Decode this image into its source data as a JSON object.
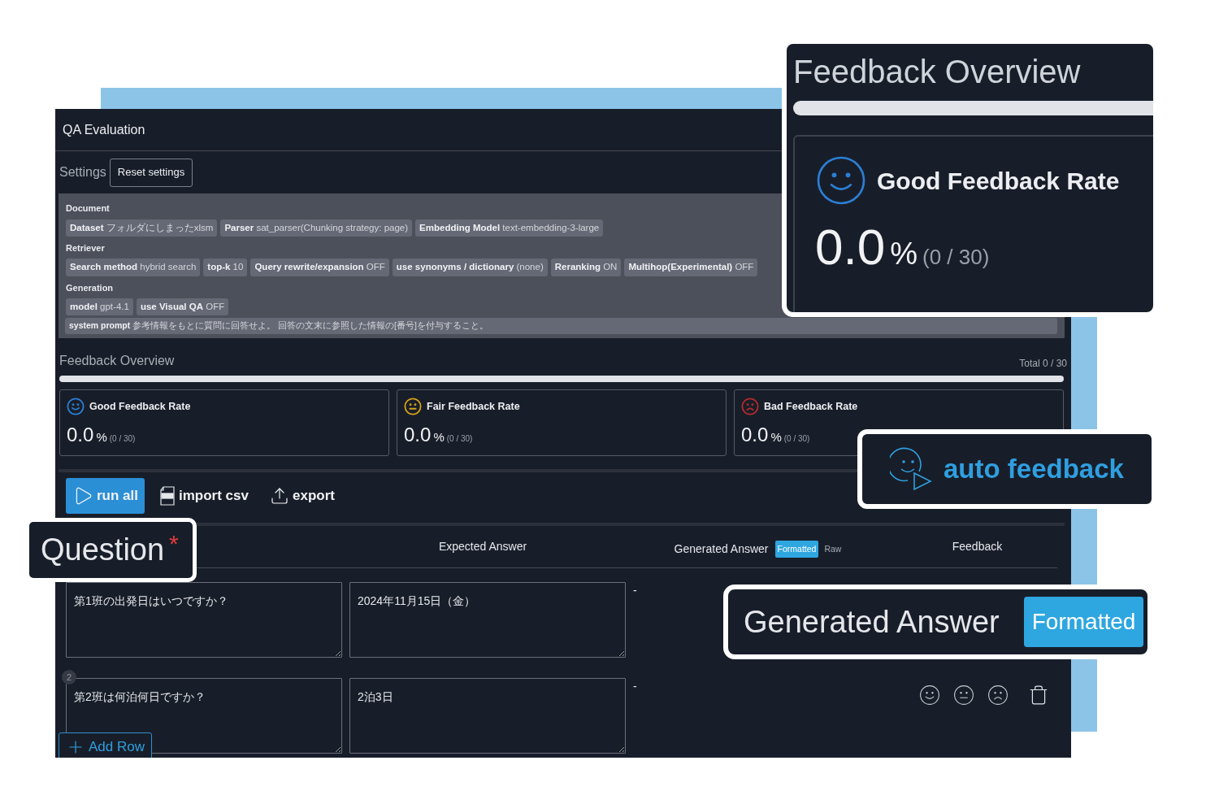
{
  "window": {
    "title": "QA Evaluation"
  },
  "settings": {
    "label": "Settings",
    "reset_button": "Reset settings",
    "groups": [
      {
        "title": "Document",
        "chips": [
          "**Dataset** フォルダにしまったxlsm",
          "**Parser** sat_parser(Chunking strategy: page)",
          "**Embedding Model** text-embedding-3-large"
        ]
      },
      {
        "title": "Retriever",
        "chips": [
          "**Search method** hybrid search",
          "**top-k** 10",
          "**Query rewrite/expansion** OFF",
          "**use synonyms / dictionary** (none)",
          "**Reranking** ON",
          "**Multihop(Experimental)** OFF"
        ]
      },
      {
        "title": "Generation",
        "chips": [
          "**model** gpt-4.1",
          "**use Visual QA** OFF"
        ]
      }
    ],
    "system_prompt": "**system prompt** 参考情報をもとに質問に回答せよ。 回答の文末に参照した情報の[番号]を付与すること。"
  },
  "feedback_overview": {
    "title": "Feedback Overview",
    "total": "Total 0 / 30",
    "level": 0,
    "cards": [
      {
        "kind": "good",
        "color": "#2b7fd4",
        "title": "Good Feedback Rate",
        "value": "0.0",
        "unit": "%",
        "count": "(0 / 30)"
      },
      {
        "kind": "fair",
        "color": "#d4a017",
        "title": "Fair Feedback Rate",
        "value": "0.0",
        "unit": "%",
        "count": "(0 / 30)"
      },
      {
        "kind": "bad",
        "color": "#b32b2b",
        "title": "Bad Feedback Rate",
        "value": "0.0",
        "unit": "%",
        "count": "(0 / 30)"
      }
    ]
  },
  "toolbar": {
    "buttons": [
      {
        "kind": "run",
        "label": "run all"
      },
      {
        "kind": "import",
        "label": "import csv"
      },
      {
        "kind": "export",
        "label": "export"
      }
    ]
  },
  "table": {
    "columns": [
      "Expected Answer",
      "Generated Answer",
      "Feedback"
    ],
    "view_toggle": [
      {
        "label": "Formatted",
        "selected": true
      },
      {
        "label": "Raw",
        "selected": false
      }
    ],
    "rows": [
      {
        "question": "第1班の出発日はいつですか？",
        "expected": "2024年11月15日（金）",
        "generated": "-"
      },
      {
        "number": "2",
        "question": "第2班は何泊何日ですか？",
        "expected": "2泊3日",
        "generated": "-"
      }
    ],
    "add_row_button": "Add Row"
  },
  "callouts": [
    {
      "kind": "overview",
      "title": "Feedback Overview",
      "level": 0,
      "card_title": "Good Feedback Rate",
      "value": "0.0",
      "unit": "%",
      "count": "(0 / 30)",
      "color": "#2b7fd4"
    },
    {
      "kind": "auto_feedback",
      "label": "auto feedback"
    },
    {
      "kind": "column",
      "label": "Question",
      "required_mark": "*"
    },
    {
      "kind": "column_toggle",
      "label": "Generated Answer",
      "button": "Formatted"
    }
  ]
}
